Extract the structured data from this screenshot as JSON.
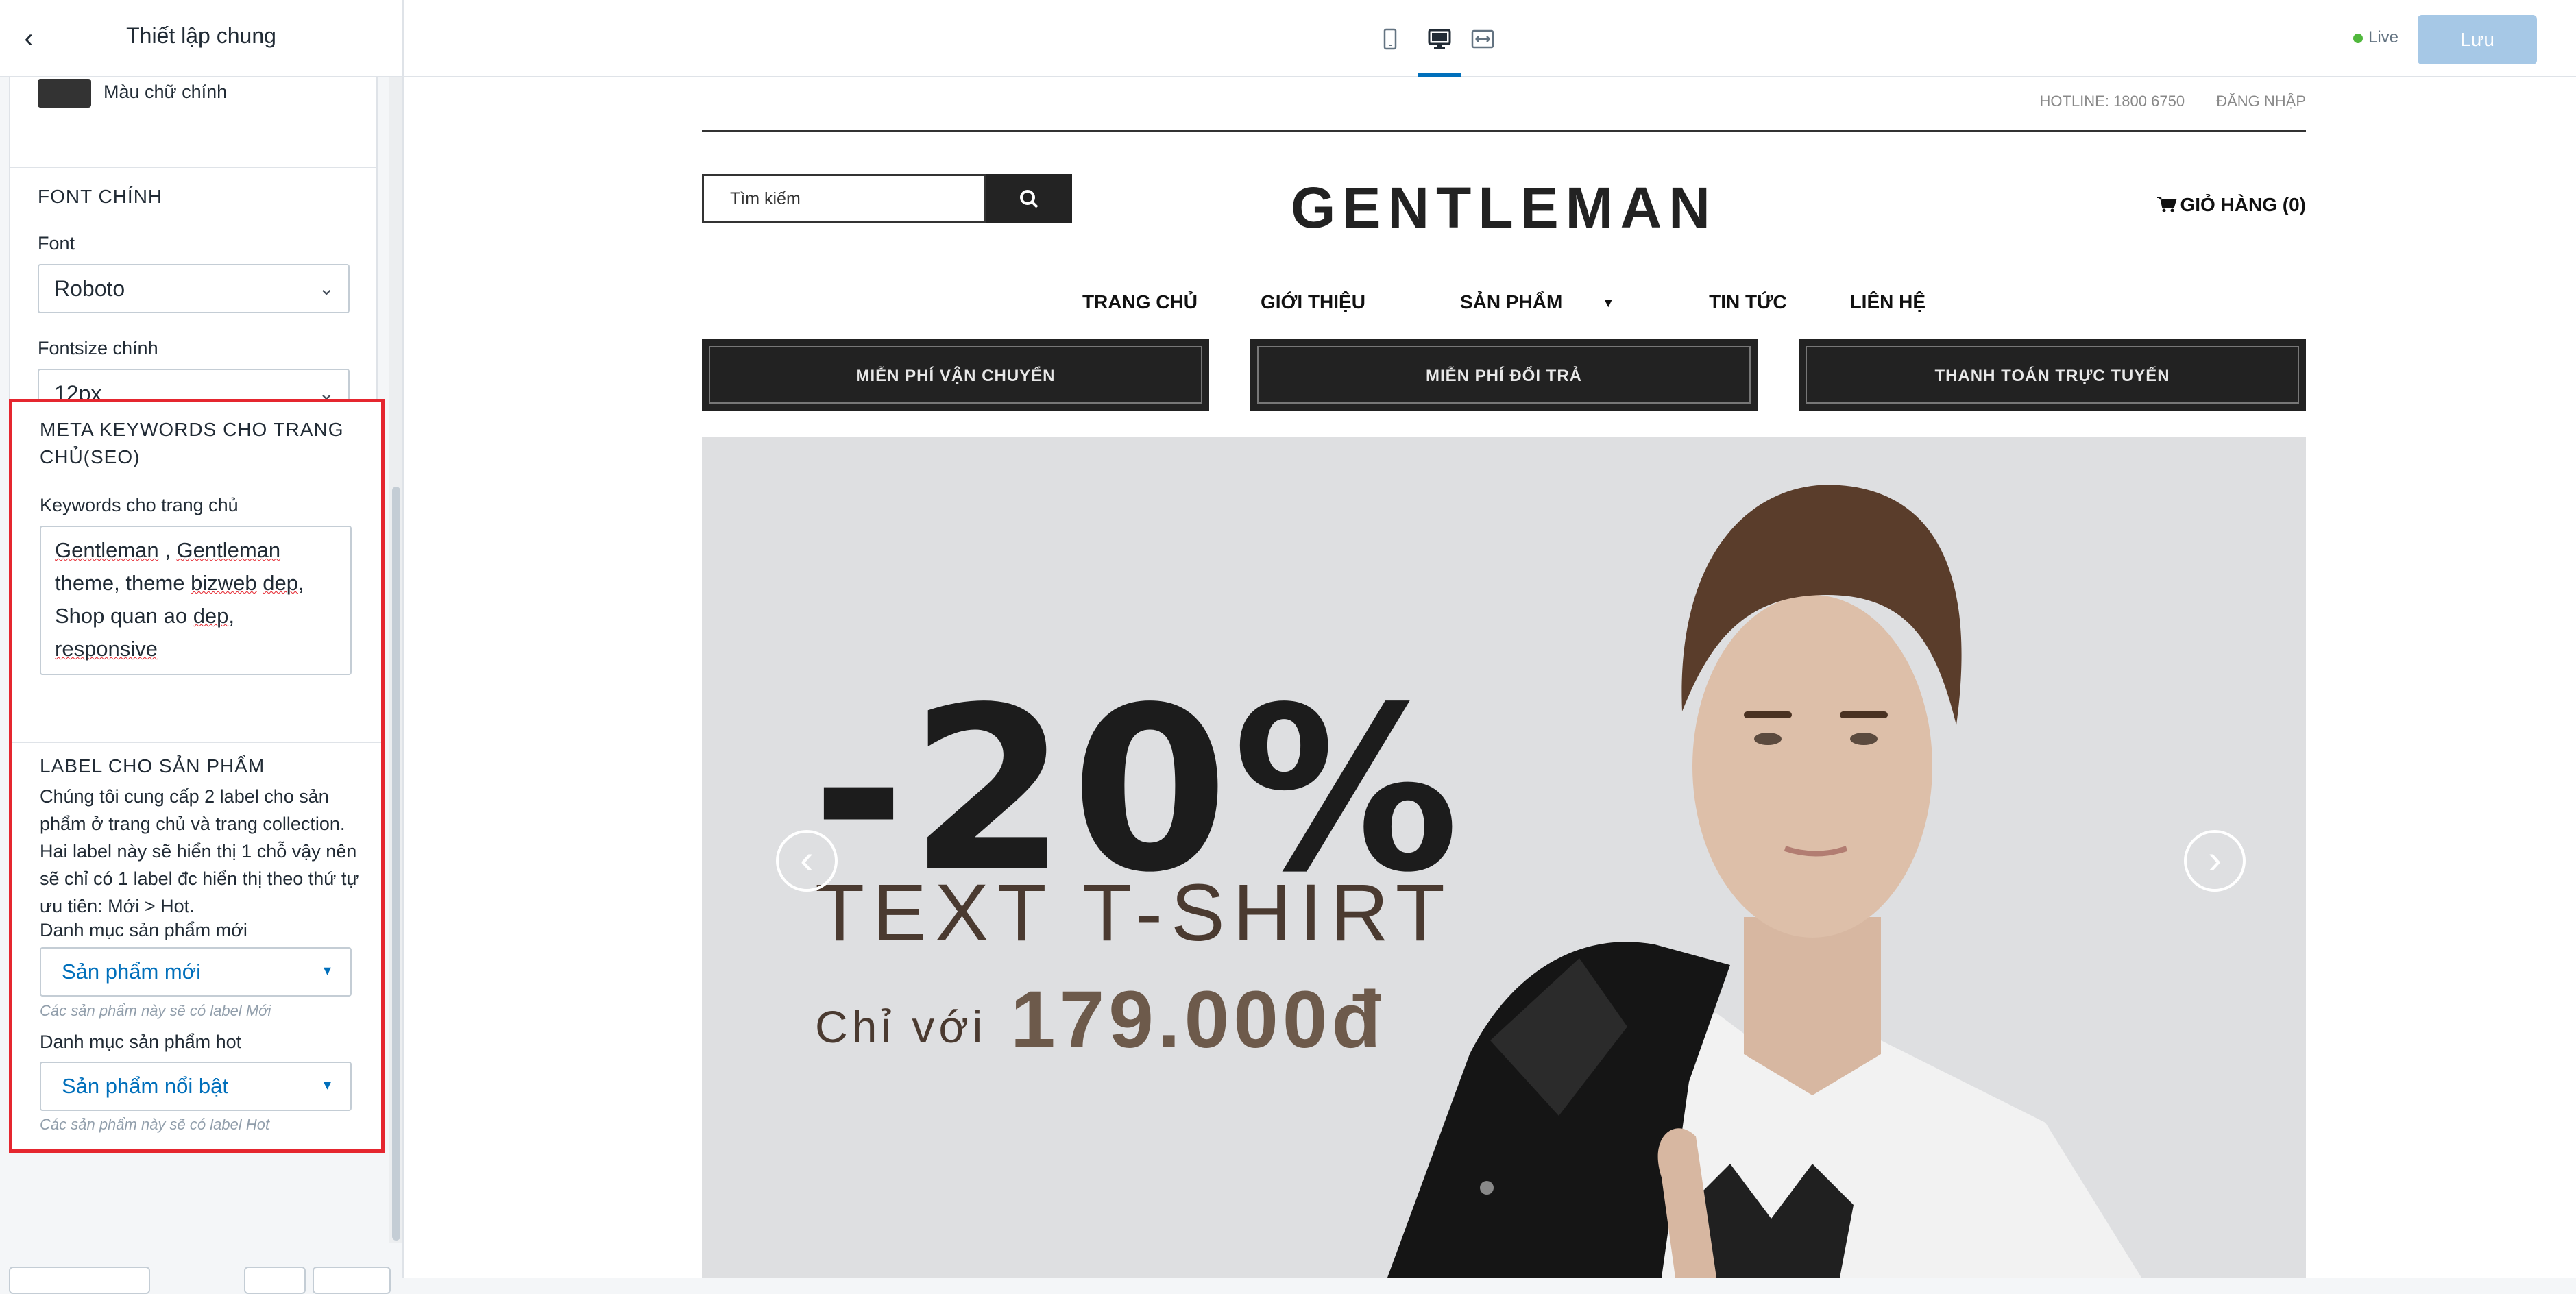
{
  "editor": {
    "title": "Thiết lập chung",
    "color_label": "Màu chữ chính",
    "font_section": {
      "title": "FONT CHÍNH",
      "font_label": "Font",
      "font_value": "Roboto",
      "size_label": "Fontsize chính",
      "size_value": "12px"
    },
    "seo_section": {
      "title": "META KEYWORDS CHO TRANG CHỦ(SEO)",
      "field_label": "Keywords cho trang chủ",
      "keywords": "Gentleman , Gentleman theme, theme bizweb dep, Shop quan ao dep, responsive"
    },
    "label_section": {
      "title": "LABEL CHO SẢN PHẨM",
      "description": "Chúng tôi cung cấp 2 label cho sản phẩm ở trang chủ và trang collection. Hai label này sẽ hiển thị 1 chỗ vậy nên sẽ chỉ có 1 label đc hiển thị theo thứ tự ưu tiên: Mới > Hot.",
      "new_label": "Danh mục sản phẩm mới",
      "new_value": "Sản phẩm mới",
      "new_hint": "Các sản phẩm này sẽ có label Mới",
      "hot_label": "Danh mục sản phẩm hot",
      "hot_value": "Sản phẩm nổi bật",
      "hot_hint": "Các sản phẩm này sẽ có label Hot"
    }
  },
  "topbar": {
    "live_label": "Live",
    "save_label": "Lưu",
    "active_device": "desktop"
  },
  "store": {
    "hotline": "HOTLINE: 1800 6750",
    "login": "ĐĂNG NHẬP",
    "search_placeholder": "Tìm kiếm",
    "logo": "GENTLEMAN",
    "cart": "GIỎ HÀNG (0)",
    "nav": [
      "TRANG CHỦ",
      "GIỚI THIỆU",
      "SẢN PHẨM",
      "TIN TỨC",
      "LIÊN HỆ"
    ],
    "policies": [
      "MIỄN PHÍ VẬN CHUYỂN",
      "MIỄN PHÍ ĐỔI TRẢ",
      "THANH TOÁN TRỰC TUYẾN"
    ],
    "banner": {
      "discount": "-20%",
      "product": "TEXT T-SHIRT",
      "price_prefix": "Chỉ với",
      "price": "179.000đ"
    }
  },
  "colors": {
    "accent": "#006fbb",
    "highlight_border": "#e5262f",
    "save_button": "#a6c8e6",
    "live_dot": "#50b83c"
  }
}
